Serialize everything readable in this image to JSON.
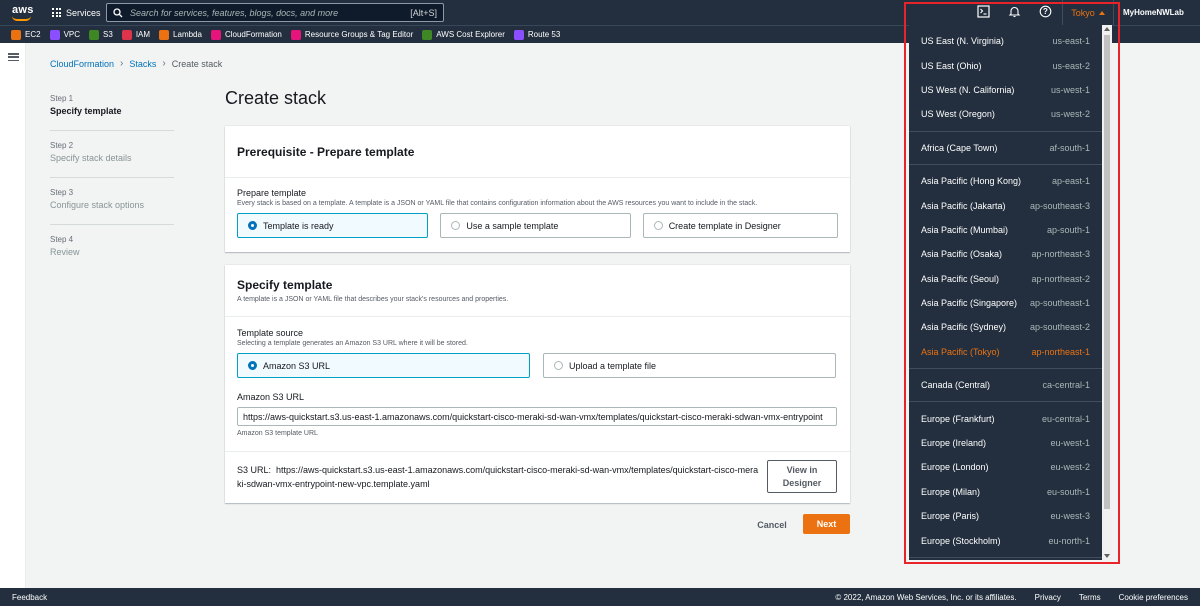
{
  "topnav": {
    "logo_text": "aws",
    "services_label": "Services",
    "search_placeholder": "Search for services, features, blogs, docs, and more",
    "search_shortcut": "[Alt+S]",
    "region_label": "Tokyo",
    "account_label": "MyHomeNWLab"
  },
  "favorites": [
    {
      "label": "EC2",
      "color": "#ec7211"
    },
    {
      "label": "VPC",
      "color": "#8c4fff"
    },
    {
      "label": "S3",
      "color": "#3f8624"
    },
    {
      "label": "IAM",
      "color": "#dd344c"
    },
    {
      "label": "Lambda",
      "color": "#ec7211"
    },
    {
      "label": "CloudFormation",
      "color": "#e7157b"
    },
    {
      "label": "Resource Groups & Tag Editor",
      "color": "#e7157b"
    },
    {
      "label": "AWS Cost Explorer",
      "color": "#3f8624"
    },
    {
      "label": "Route 53",
      "color": "#8c4fff"
    }
  ],
  "breadcrumb": {
    "item1": "CloudFormation",
    "item2": "Stacks",
    "current": "Create stack"
  },
  "steps": [
    {
      "num": "Step 1",
      "name": "Specify template"
    },
    {
      "num": "Step 2",
      "name": "Specify stack details"
    },
    {
      "num": "Step 3",
      "name": "Configure stack options"
    },
    {
      "num": "Step 4",
      "name": "Review"
    }
  ],
  "page_title": "Create stack",
  "prereq": {
    "title": "Prerequisite - Prepare template",
    "label": "Prepare template",
    "desc": "Every stack is based on a template. A template is a JSON or YAML file that contains configuration information about the AWS resources you want to include in the stack.",
    "options": [
      "Template is ready",
      "Use a sample template",
      "Create template in Designer"
    ]
  },
  "specify": {
    "title": "Specify template",
    "subtitle": "A template is a JSON or YAML file that describes your stack's resources and properties.",
    "source_label": "Template source",
    "source_desc": "Selecting a template generates an Amazon S3 URL where it will be stored.",
    "options": [
      "Amazon S3 URL",
      "Upload a template file"
    ],
    "url_label": "Amazon S3 URL",
    "url_value": "https://aws-quickstart.s3.us-east-1.amazonaws.com/quickstart-cisco-meraki-sd-wan-vmx/templates/quickstart-cisco-meraki-sdwan-vmx-entrypoint",
    "url_hint": "Amazon S3 template URL",
    "s3url_prefix": "S3 URL:",
    "s3url_line1": "https://aws-quickstart.s3.us-east-1.amazonaws.com/quickstart-cisco-meraki-sd-wan-vmx/templates/quickstart-cisco-mera",
    "s3url_line2": "ki-sdwan-vmx-entrypoint-new-vpc.template.yaml",
    "designer_btn": "View in Designer"
  },
  "actions": {
    "cancel": "Cancel",
    "next": "Next"
  },
  "regions": [
    [
      {
        "name": "US East (N. Virginia)",
        "code": "us-east-1"
      },
      {
        "name": "US East (Ohio)",
        "code": "us-east-2"
      },
      {
        "name": "US West (N. California)",
        "code": "us-west-1"
      },
      {
        "name": "US West (Oregon)",
        "code": "us-west-2"
      }
    ],
    [
      {
        "name": "Africa (Cape Town)",
        "code": "af-south-1"
      }
    ],
    [
      {
        "name": "Asia Pacific (Hong Kong)",
        "code": "ap-east-1"
      },
      {
        "name": "Asia Pacific (Jakarta)",
        "code": "ap-southeast-3"
      },
      {
        "name": "Asia Pacific (Mumbai)",
        "code": "ap-south-1"
      },
      {
        "name": "Asia Pacific (Osaka)",
        "code": "ap-northeast-3"
      },
      {
        "name": "Asia Pacific (Seoul)",
        "code": "ap-northeast-2"
      },
      {
        "name": "Asia Pacific (Singapore)",
        "code": "ap-southeast-1"
      },
      {
        "name": "Asia Pacific (Sydney)",
        "code": "ap-southeast-2"
      },
      {
        "name": "Asia Pacific (Tokyo)",
        "code": "ap-northeast-1",
        "current": true
      }
    ],
    [
      {
        "name": "Canada (Central)",
        "code": "ca-central-1"
      }
    ],
    [
      {
        "name": "Europe (Frankfurt)",
        "code": "eu-central-1"
      },
      {
        "name": "Europe (Ireland)",
        "code": "eu-west-1"
      },
      {
        "name": "Europe (London)",
        "code": "eu-west-2"
      },
      {
        "name": "Europe (Milan)",
        "code": "eu-south-1"
      },
      {
        "name": "Europe (Paris)",
        "code": "eu-west-3"
      },
      {
        "name": "Europe (Stockholm)",
        "code": "eu-north-1"
      }
    ]
  ],
  "footer": {
    "feedback": "Feedback",
    "copyright": "© 2022, Amazon Web Services, Inc. or its affiliates.",
    "privacy": "Privacy",
    "terms": "Terms",
    "cookies": "Cookie preferences"
  },
  "colors": {
    "accent": "#ec7211",
    "nav": "#232f3e",
    "link": "#0073bb",
    "highlight": "#e8232a"
  }
}
